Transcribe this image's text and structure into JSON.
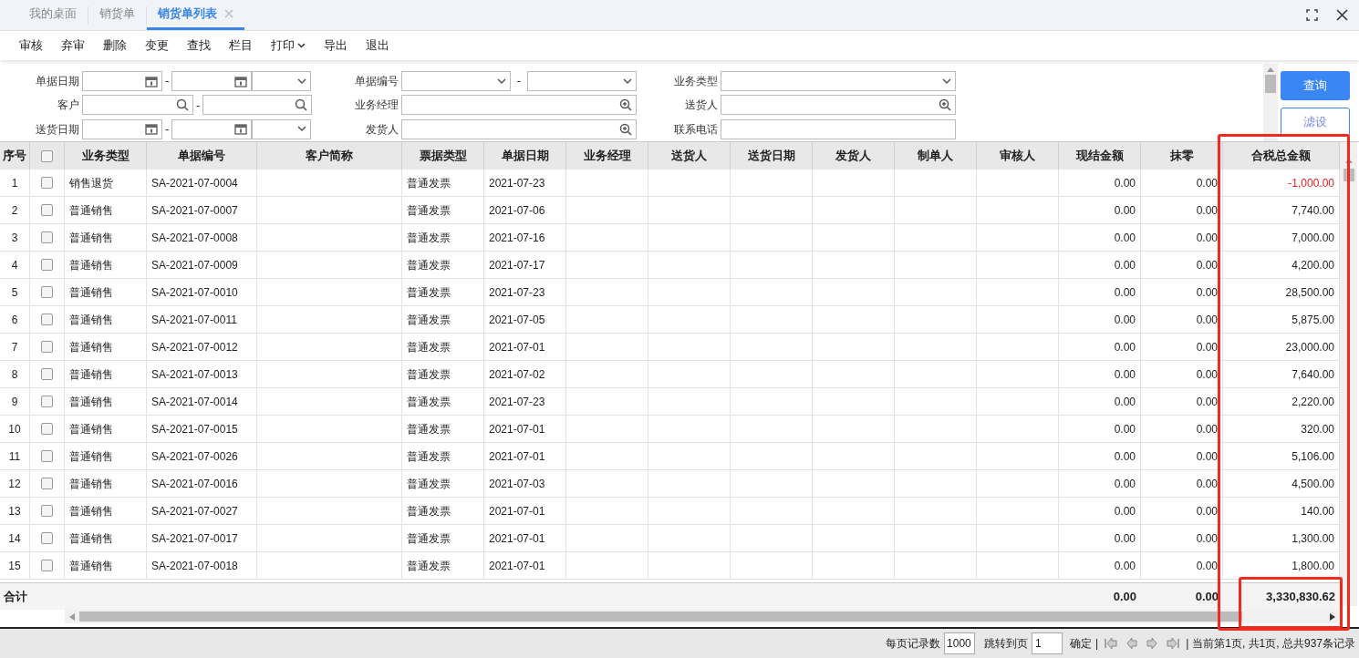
{
  "tabs": [
    {
      "label": "我的桌面",
      "selected": false,
      "closable": false
    },
    {
      "label": "销货单",
      "selected": false,
      "closable": false
    },
    {
      "label": "销货单列表",
      "selected": true,
      "closable": true
    }
  ],
  "toolbar": [
    {
      "label": "审核",
      "kind": "plain"
    },
    {
      "label": "弃审",
      "kind": "plain"
    },
    {
      "label": "删除",
      "kind": "plain"
    },
    {
      "label": "变更",
      "kind": "plain"
    },
    {
      "label": "查找",
      "kind": "plain"
    },
    {
      "label": "栏目",
      "kind": "plain"
    },
    {
      "label": "打印",
      "kind": "menu"
    },
    {
      "label": "导出",
      "kind": "plain"
    },
    {
      "label": "退出",
      "kind": "plain"
    }
  ],
  "filters": [
    [
      {
        "label": "单据日期",
        "kind": "date-range",
        "separator": "-"
      },
      {
        "label": "客户",
        "kind": "search-range",
        "separator": "-"
      },
      {
        "label": "送货日期",
        "kind": "date-range",
        "separator": "-"
      }
    ],
    [
      {
        "label": "单据编号",
        "kind": "select-range",
        "separator": "-"
      },
      {
        "label": "业务经理",
        "kind": "person"
      },
      {
        "label": "发货人",
        "kind": "person"
      }
    ],
    [
      {
        "label": "业务类型",
        "kind": "select"
      },
      {
        "label": "送货人",
        "kind": "person"
      },
      {
        "label": "联系电话",
        "kind": "text"
      }
    ]
  ],
  "buttons": [
    {
      "label": "查询",
      "kind": "primary"
    },
    {
      "label": "滤设",
      "kind": "outline"
    }
  ],
  "table": {
    "columns": [
      "序号",
      "",
      "业务类型",
      "单据编号",
      "客户简称",
      "票据类型",
      "单据日期",
      "业务经理",
      "送货人",
      "送货日期",
      "发货人",
      "制单人",
      "审核人",
      "现结金额",
      "抹零",
      "合税总金额"
    ],
    "header_checked": false,
    "rows": [
      {
        "no": "1",
        "checked": false,
        "type": "销售退货",
        "number": "SA-2021-07-0004",
        "invoice": "普通发票",
        "date": "2021-07-23",
        "cash": "0.00",
        "rounding": "0.00",
        "total": "-1,000.00",
        "negative": true
      },
      {
        "no": "2",
        "checked": false,
        "type": "普通销售",
        "number": "SA-2021-07-0007",
        "invoice": "普通发票",
        "date": "2021-07-06",
        "cash": "0.00",
        "rounding": "0.00",
        "total": "7,740.00",
        "negative": false
      },
      {
        "no": "3",
        "checked": false,
        "type": "普通销售",
        "number": "SA-2021-07-0008",
        "invoice": "普通发票",
        "date": "2021-07-16",
        "cash": "0.00",
        "rounding": "0.00",
        "total": "7,000.00",
        "negative": false
      },
      {
        "no": "4",
        "checked": false,
        "type": "普通销售",
        "number": "SA-2021-07-0009",
        "invoice": "普通发票",
        "date": "2021-07-17",
        "cash": "0.00",
        "rounding": "0.00",
        "total": "4,200.00",
        "negative": false
      },
      {
        "no": "5",
        "checked": false,
        "type": "普通销售",
        "number": "SA-2021-07-0010",
        "invoice": "普通发票",
        "date": "2021-07-23",
        "cash": "0.00",
        "rounding": "0.00",
        "total": "28,500.00",
        "negative": false
      },
      {
        "no": "6",
        "checked": false,
        "type": "普通销售",
        "number": "SA-2021-07-0011",
        "invoice": "普通发票",
        "date": "2021-07-05",
        "cash": "0.00",
        "rounding": "0.00",
        "total": "5,875.00",
        "negative": false
      },
      {
        "no": "7",
        "checked": false,
        "type": "普通销售",
        "number": "SA-2021-07-0012",
        "invoice": "普通发票",
        "date": "2021-07-01",
        "cash": "0.00",
        "rounding": "0.00",
        "total": "23,000.00",
        "negative": false
      },
      {
        "no": "8",
        "checked": false,
        "type": "普通销售",
        "number": "SA-2021-07-0013",
        "invoice": "普通发票",
        "date": "2021-07-02",
        "cash": "0.00",
        "rounding": "0.00",
        "total": "7,640.00",
        "negative": false
      },
      {
        "no": "9",
        "checked": false,
        "type": "普通销售",
        "number": "SA-2021-07-0014",
        "invoice": "普通发票",
        "date": "2021-07-23",
        "cash": "0.00",
        "rounding": "0.00",
        "total": "2,220.00",
        "negative": false
      },
      {
        "no": "10",
        "checked": false,
        "type": "普通销售",
        "number": "SA-2021-07-0015",
        "invoice": "普通发票",
        "date": "2021-07-01",
        "cash": "0.00",
        "rounding": "0.00",
        "total": "320.00",
        "negative": false
      },
      {
        "no": "11",
        "checked": false,
        "type": "普通销售",
        "number": "SA-2021-07-0026",
        "invoice": "普通发票",
        "date": "2021-07-01",
        "cash": "0.00",
        "rounding": "0.00",
        "total": "5,106.00",
        "negative": false
      },
      {
        "no": "12",
        "checked": false,
        "type": "普通销售",
        "number": "SA-2021-07-0016",
        "invoice": "普通发票",
        "date": "2021-07-03",
        "cash": "0.00",
        "rounding": "0.00",
        "total": "4,500.00",
        "negative": false
      },
      {
        "no": "13",
        "checked": false,
        "type": "普通销售",
        "number": "SA-2021-07-0027",
        "invoice": "普通发票",
        "date": "2021-07-01",
        "cash": "0.00",
        "rounding": "0.00",
        "total": "140.00",
        "negative": false
      },
      {
        "no": "14",
        "checked": false,
        "type": "普通销售",
        "number": "SA-2021-07-0017",
        "invoice": "普通发票",
        "date": "2021-07-01",
        "cash": "0.00",
        "rounding": "0.00",
        "total": "1,300.00",
        "negative": false
      },
      {
        "no": "15",
        "checked": false,
        "type": "普通销售",
        "number": "SA-2021-07-0018",
        "invoice": "普通发票",
        "date": "2021-07-01",
        "cash": "0.00",
        "rounding": "0.00",
        "total": "1,800.00",
        "negative": false
      }
    ],
    "totals": {
      "label": "合计",
      "cash": "0.00",
      "rounding": "0.00",
      "total": "3,330,830.62"
    }
  },
  "pager": {
    "page_size_label": "每页记录数",
    "page_size": "1000",
    "jump_label": "跳转到页",
    "page": "1",
    "confirm": "确定",
    "separator": "|",
    "separator_2": "|",
    "status": "当前第1页, 共1页, 总共937条记录"
  }
}
